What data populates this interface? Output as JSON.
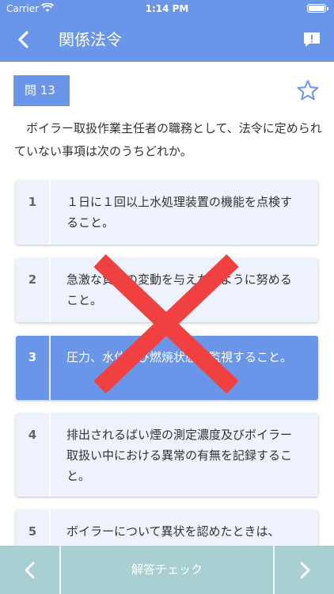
{
  "status_bar": {
    "carrier": "Carrier",
    "time": "1:14 PM"
  },
  "nav": {
    "title": "関係法令"
  },
  "question": {
    "number_label": "問 13",
    "text": "　ボイラー取扱作業主任者の職務として、法令に定められていない事項は次のうちどれか。"
  },
  "choices": [
    {
      "number": "1",
      "text": "１日に１回以上水処理装置の機能を点検すること。"
    },
    {
      "number": "2",
      "text": "急激な負荷の変動を与えないように努めること。"
    },
    {
      "number": "3",
      "text": "圧力、水位及び燃焼状態を監視すること。"
    },
    {
      "number": "4",
      "text": "排出されるばい煙の測定濃度及びボイラー取扱い中における異常の有無を記録すること。"
    },
    {
      "number": "5",
      "text": "ボイラーについて異状を認めたときは、"
    }
  ],
  "selected_choice": "3",
  "result": "incorrect",
  "bottom_bar": {
    "check_label": "解答チェック"
  },
  "colors": {
    "primary": "#6a96ea",
    "choice_bg": "#eef2fd",
    "bottom_bar": "#a8cfd1",
    "wrong_mark": "#f04040"
  },
  "icons": {
    "back": "chevron-left-icon",
    "report": "report-icon",
    "favorite": "star-icon",
    "prev": "chevron-left-icon",
    "next": "chevron-right-icon",
    "wrong": "cross-mark-icon"
  }
}
